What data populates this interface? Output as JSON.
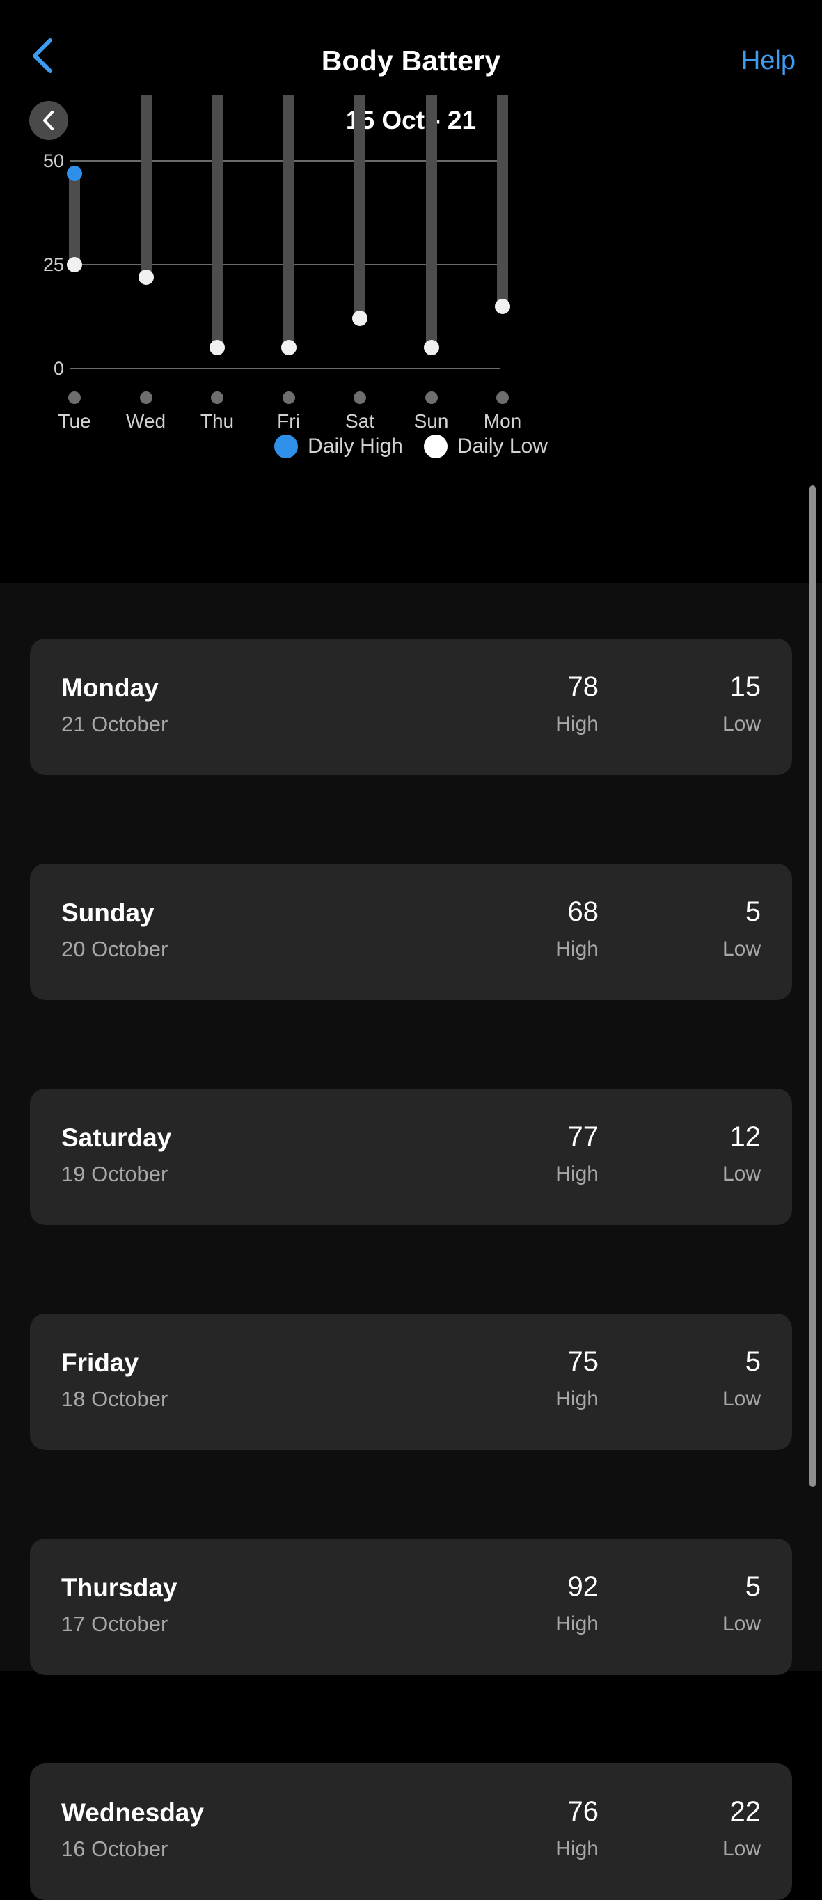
{
  "navbar": {
    "back_icon": "chevron-left-icon",
    "title": "Body Battery",
    "help_label": "Help",
    "accent_color": "#3d9cf0"
  },
  "week_nav": {
    "prev_icon": "chevron-left-icon",
    "range_label": "15 Oct - 21"
  },
  "legend": {
    "high_label": "Daily High",
    "high_color": "#2e90e8",
    "low_label": "Daily Low",
    "low_color": "#ffffff"
  },
  "chart_data": {
    "type": "bar",
    "title": "15 Oct - 21",
    "xlabel": "",
    "ylabel": "",
    "ylim": [
      0,
      50
    ],
    "yticks": [
      "0",
      "25",
      "50"
    ],
    "grid": true,
    "legend_position": "bottom",
    "categories": [
      "Tue",
      "Wed",
      "Thu",
      "Fri",
      "Sat",
      "Sun",
      "Mon"
    ],
    "series": [
      {
        "name": "Daily High",
        "values": [
          47,
          76,
          92,
          75,
          77,
          68,
          78
        ]
      },
      {
        "name": "Daily Low",
        "values": [
          25,
          22,
          5,
          5,
          12,
          5,
          15
        ]
      }
    ],
    "note": "Bars are clipped at the top of the visible plot area; only Tue's high marker falls inside the 0-50 range."
  },
  "list": {
    "col_high_label": "High",
    "col_low_label": "Low",
    "rows": [
      {
        "day": "Monday",
        "date": "21 October",
        "high": "78",
        "low": "15"
      },
      {
        "day": "Sunday",
        "date": "20 October",
        "high": "68",
        "low": "5"
      },
      {
        "day": "Saturday",
        "date": "19 October",
        "high": "77",
        "low": "12"
      },
      {
        "day": "Friday",
        "date": "18 October",
        "high": "75",
        "low": "5"
      },
      {
        "day": "Thursday",
        "date": "17 October",
        "high": "92",
        "low": "5"
      },
      {
        "day": "Wednesday",
        "date": "16 October",
        "high": "76",
        "low": "22"
      }
    ]
  }
}
